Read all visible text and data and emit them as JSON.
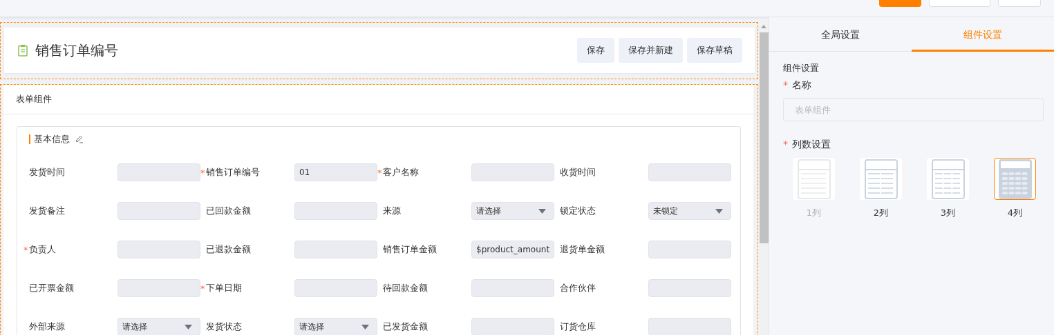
{
  "top_bar": {
    "buttons": [
      {
        "kind": "primary"
      },
      {
        "kind": "default"
      },
      {
        "kind": "default"
      }
    ]
  },
  "header": {
    "title": "销售订单编号",
    "buttons": [
      "保存",
      "保存并新建",
      "保存草稿"
    ]
  },
  "form_component": {
    "title": "表单组件",
    "group": {
      "title": "基本信息",
      "fields": [
        {
          "label": "发货时间",
          "kind": "input"
        },
        {
          "required_mark": "*",
          "label": "销售订单编号",
          "kind": "input",
          "value": "01"
        },
        {
          "required_mark": "*",
          "label": "客户名称",
          "kind": "input"
        },
        {
          "label": "收货时间",
          "kind": "input"
        },
        {
          "label": "发货备注",
          "kind": "input"
        },
        {
          "label": "已回款金额",
          "kind": "input"
        },
        {
          "label": "来源",
          "kind": "select",
          "placeholder": "请选择"
        },
        {
          "label": "锁定状态",
          "kind": "select",
          "value": "未锁定"
        },
        {
          "required_mark": "*",
          "label": "负责人",
          "kind": "input"
        },
        {
          "label": "已退款金额",
          "kind": "input"
        },
        {
          "label": "销售订单金额",
          "kind": "input",
          "value": "$product_amount"
        },
        {
          "label": "退货单金额",
          "kind": "input"
        },
        {
          "label": "已开票金额",
          "kind": "input"
        },
        {
          "required_mark": "*",
          "label": "下单日期",
          "kind": "input"
        },
        {
          "label": "待回款金额",
          "kind": "input"
        },
        {
          "label": "合作伙伴",
          "kind": "input"
        },
        {
          "label": "外部来源",
          "kind": "select",
          "placeholder": "请选择"
        },
        {
          "label": "发货状态",
          "kind": "select",
          "placeholder": "请选择"
        },
        {
          "label": "已发货金额",
          "kind": "input"
        },
        {
          "label": "订货仓库",
          "kind": "input"
        }
      ]
    }
  },
  "settings_panel": {
    "tabs": [
      {
        "label": "全局设置",
        "selected": false
      },
      {
        "label": "组件设置",
        "selected": true
      }
    ],
    "section_title": "组件设置",
    "name_field": {
      "required_mark": "*",
      "label": "名称",
      "placeholder": "表单组件"
    },
    "columns_setting": {
      "required_mark": "*",
      "label": "列数设置",
      "options": [
        {
          "label": "1列",
          "disabled": true,
          "selected": false
        },
        {
          "label": "2列",
          "disabled": false,
          "selected": false
        },
        {
          "label": "3列",
          "disabled": false,
          "selected": false
        },
        {
          "label": "4列",
          "disabled": false,
          "selected": true
        }
      ]
    }
  }
}
